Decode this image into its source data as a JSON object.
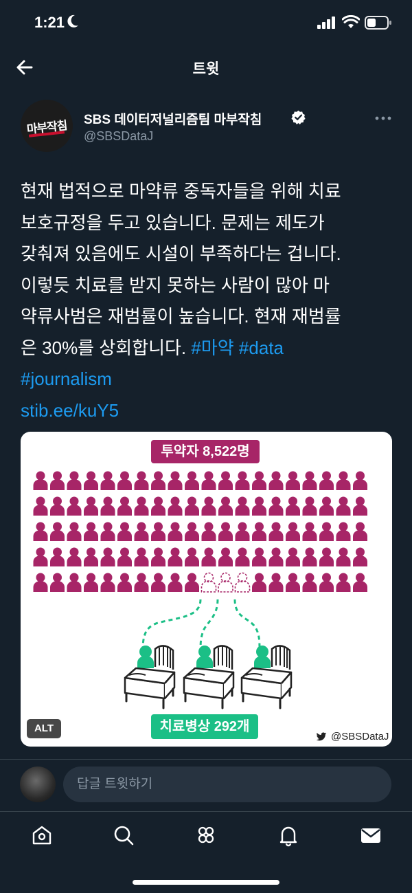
{
  "status_bar": {
    "time": "1:21"
  },
  "header": {
    "title": "트윗"
  },
  "tweet": {
    "avatar_text": "마부작침",
    "author_name": "SBS 데이터저널리즘팀 마부작침",
    "author_handle": "@SBSDataJ",
    "text_lines": [
      "현재 법적으로 마약류 중독자들을 위해 치료",
      "보호규정을 두고 있습니다. 문제는 제도가",
      "갖춰져 있음에도 시설이 부족하다는 겁니다.",
      "이렇듯 치료를 받지 못하는 사람이 많아 마",
      "약류사범은 재범률이 높습니다. 현재 재범률"
    ],
    "text_last_plain": "은 30%를 상회합니다. ",
    "hashtags": [
      "#마약",
      "#data",
      "#journalism"
    ],
    "link": "stib.ee/kuY5"
  },
  "media": {
    "label_top": "투약자 8,522명",
    "label_bottom": "치료병상 292개",
    "alt_badge": "ALT",
    "credit": "@SBSDataJ",
    "colors": {
      "addict": "#a72567",
      "treated": "#1bbf86"
    }
  },
  "reply": {
    "placeholder": "답글 트윗하기"
  },
  "nav": [
    "home-icon",
    "search-icon",
    "communities-icon",
    "notifications-icon",
    "messages-icon"
  ],
  "colors": {
    "background": "#15202b",
    "link": "#1d9bf0",
    "muted": "#8b98a5"
  }
}
